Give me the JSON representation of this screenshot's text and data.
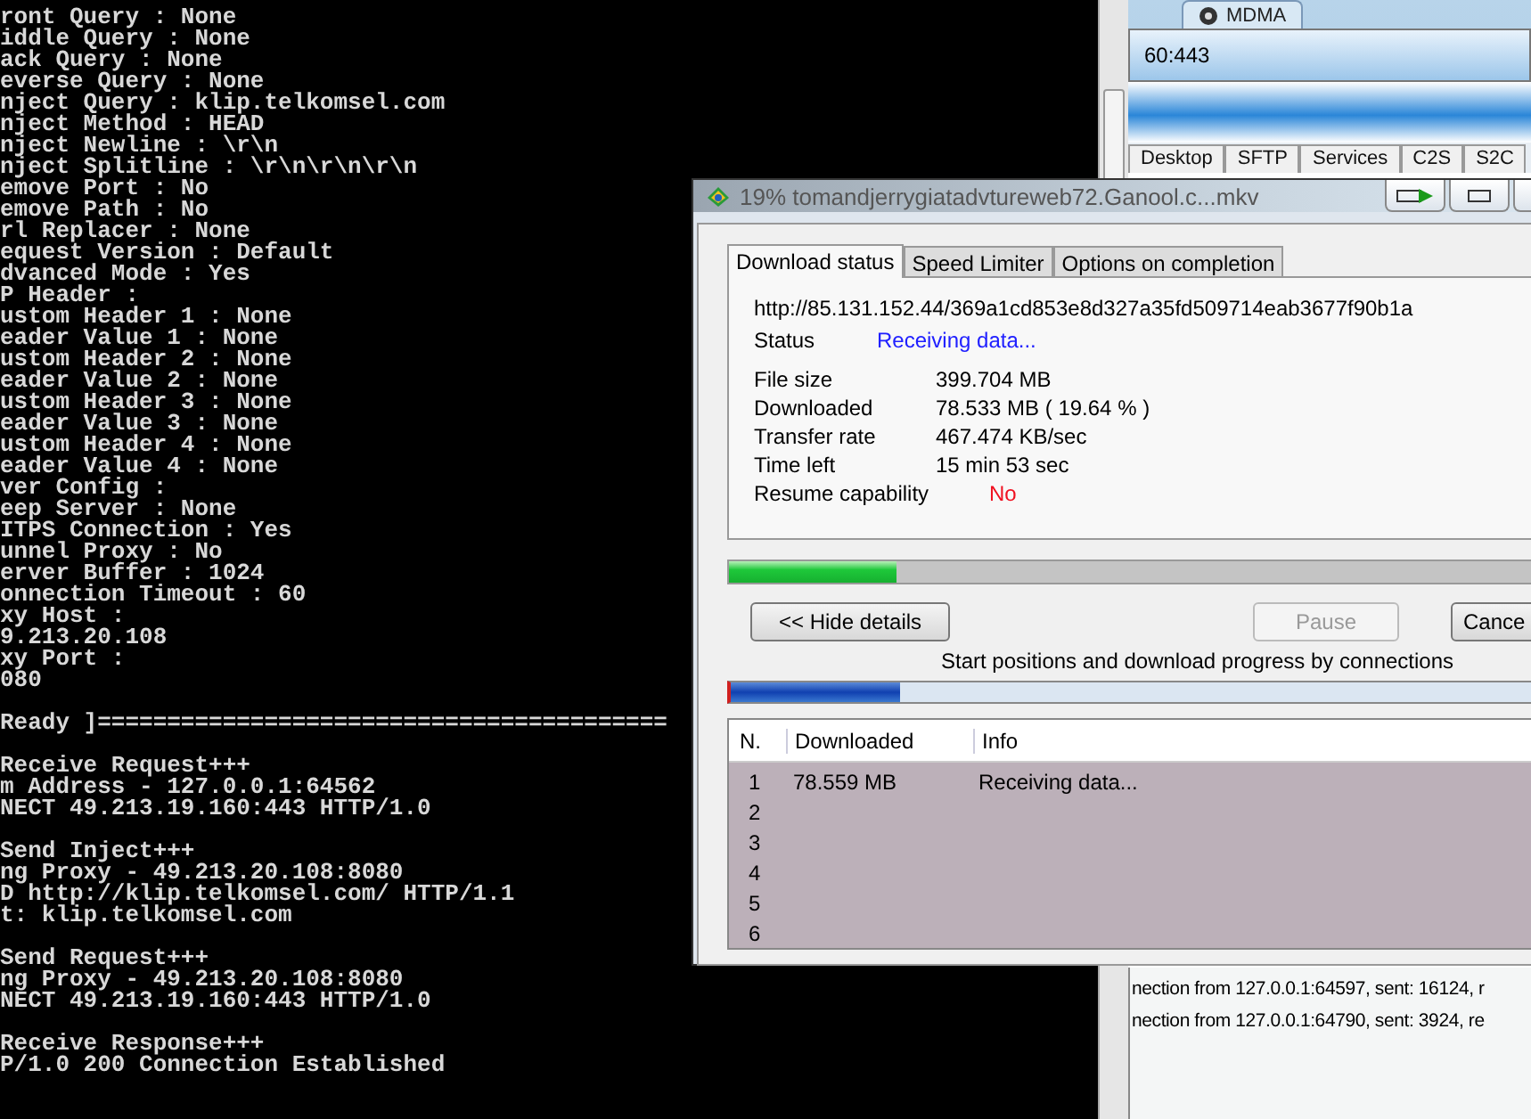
{
  "console": {
    "blocks": [
      {
        "lines": [
          "ront Query : None",
          "iddle Query : None",
          "ack Query : None",
          "everse Query : None",
          "nject Query : klip.telkomsel.com",
          "nject Method : HEAD",
          "nject Newline : \\r\\n",
          "nject Splitline : \\r\\n\\r\\n\\r\\n",
          "emove Port : No",
          "emove Path : No",
          "rl Replacer : None",
          "equest Version : Default",
          "dvanced Mode : Yes",
          "P Header :",
          "ustom Header 1 : None",
          "eader Value 1 : None",
          "ustom Header 2 : None",
          "eader Value 2 : None",
          "ustom Header 3 : None",
          "eader Value 3 : None",
          "ustom Header 4 : None",
          "eader Value 4 : None",
          "ver Config :",
          "eep Server : None",
          "ITPS Connection : Yes",
          "unnel Proxy : No",
          "erver Buffer : 1024",
          "onnection Timeout : 60",
          "xy Host :",
          "9.213.20.108",
          "xy Port :",
          "080"
        ]
      },
      {
        "lines": [
          "Ready ]========================================="
        ]
      },
      {
        "lines": [
          "Receive Request+++",
          "m Address - 127.0.0.1:64562",
          "NECT 49.213.19.160:443 HTTP/1.0"
        ]
      },
      {
        "lines": [
          "Send Inject+++",
          "ng Proxy - 49.213.20.108:8080",
          "D http://klip.telkomsel.com/ HTTP/1.1",
          "t: klip.telkomsel.com"
        ]
      },
      {
        "lines": [
          "Send Request+++",
          "ng Proxy - 49.213.20.108:8080",
          "NECT 49.213.19.160:443 HTTP/1.0"
        ]
      },
      {
        "lines": [
          "Receive Response+++",
          "P/1.0 200 Connection Established"
        ]
      }
    ]
  },
  "background_window": {
    "tab": "MDMA",
    "address": "60:443",
    "tabs": [
      "Desktop",
      "SFTP",
      "Services",
      "C2S",
      "S2C"
    ],
    "log_lines": [
      "nection from 127.0.0.1:64597, sent: 16124, r",
      "nection from 127.0.0.1:64790, sent: 3924, re"
    ]
  },
  "dialog": {
    "title": "19% tomandjerrygiatadvtureweb72.Ganool.c...mkv",
    "tabs": [
      {
        "label": "Download status",
        "selected": true
      },
      {
        "label": "Speed Limiter",
        "selected": false
      },
      {
        "label": "Options on completion",
        "selected": false
      }
    ],
    "url": "http://85.131.152.44/369a1cd853e8d327a35fd509714eab3677f90b1a",
    "status": {
      "label": "Status",
      "value": "Receiving data..."
    },
    "details": [
      {
        "label": "File size",
        "value": "399.704  MB",
        "kind": "plain"
      },
      {
        "label": "Downloaded",
        "value": "78.533  MB  ( 19.64 % )",
        "kind": "plain"
      },
      {
        "label": "Transfer rate",
        "value": "467.474  KB/sec",
        "kind": "plain"
      },
      {
        "label": "Time left",
        "value": "15 min 53 sec",
        "kind": "plain"
      },
      {
        "label": "Resume capability",
        "value": "No",
        "kind": "alert"
      }
    ],
    "progress": {
      "level": 0.1964
    },
    "buttons": [
      {
        "label": "<< Hide details",
        "disabled": false
      },
      {
        "label": "Pause",
        "disabled": true
      },
      {
        "label": "Cance",
        "disabled": false
      }
    ],
    "connections_caption": "Start positions and download progress by connections",
    "connections_bar": {
      "level": 0.2
    },
    "table": {
      "columns": [
        "N.",
        "Downloaded",
        "Info"
      ],
      "rows": [
        {
          "cells": [
            "1",
            "78.559  MB",
            "Receiving data..."
          ]
        },
        {
          "cells": [
            "2"
          ]
        },
        {
          "cells": [
            "3"
          ]
        },
        {
          "cells": [
            "4"
          ]
        },
        {
          "cells": [
            "5"
          ]
        },
        {
          "cells": [
            "6"
          ]
        }
      ]
    }
  }
}
